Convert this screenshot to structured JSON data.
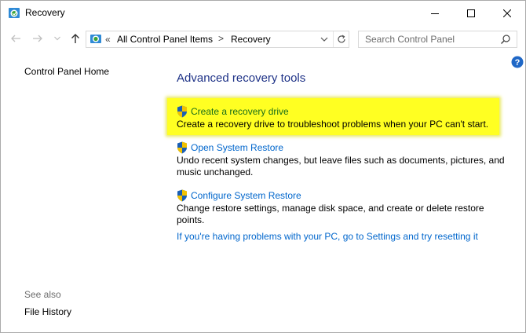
{
  "window": {
    "title": "Recovery"
  },
  "navigation": {
    "breadcrumb": {
      "overflow": "«",
      "items": [
        "All Control Panel Items",
        "Recovery"
      ],
      "separator": ">"
    },
    "search": {
      "placeholder": "Search Control Panel"
    }
  },
  "sidebar": {
    "home": "Control Panel Home",
    "see_also_label": "See also",
    "see_also_items": [
      "File History"
    ]
  },
  "main": {
    "heading": "Advanced recovery tools",
    "tasks": [
      {
        "link": "Create a recovery drive",
        "description": "Create a recovery drive to troubleshoot problems when your PC can't start.",
        "highlighted": true
      },
      {
        "link": "Open System Restore",
        "description": "Undo recent system changes, but leave files such as documents, pictures, and music unchanged.",
        "highlighted": false
      },
      {
        "link": "Configure System Restore",
        "description": "Change restore settings, manage disk space, and create or delete restore points.",
        "highlighted": false
      }
    ],
    "reset_link": "If you're having problems with your PC, go to Settings and try resetting it"
  },
  "colors": {
    "link": "#0066cc",
    "heading": "#1e3287",
    "highlight": "#ffff22"
  }
}
